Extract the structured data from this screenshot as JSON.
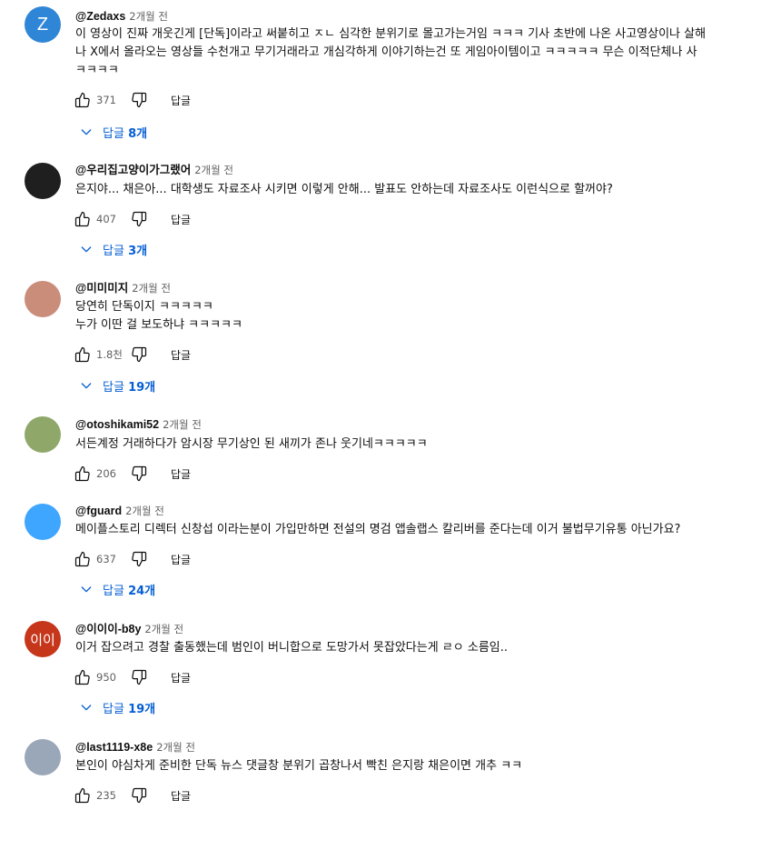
{
  "colors": {
    "accent_link": "#065fd4",
    "secondary_text": "#606060",
    "primary_text": "#0f0f0f"
  },
  "comments": [
    {
      "avatar_letter": "Z",
      "avatar_color": "#2f86d6",
      "author": "@Zedaxs",
      "time": "2개월 전",
      "lines": [
        "이 영상이 진짜 개웃긴게 [단독]이라고 써붙히고 ㅈㄴ 심각한 분위기로 몰고가는거임 ㅋㅋㅋ 기사 초반에 나온 사고영상이나 살해",
        "나 X에서 올라오는 영상들 수천개고 무기거래라고 개심각하게 이야기하는건 또 게임아이템이고 ㅋㅋㅋㅋㅋ 무슨 이적단체나 사",
        "ㅋㅋㅋㅋ"
      ],
      "likes": "371",
      "reply_label": "답글",
      "replies_toggle": "답글 8개"
    },
    {
      "avatar_letter": "",
      "avatar_color": "#1f1f1f",
      "author": "@우리집고양이가그랬어",
      "time": "2개월 전",
      "lines": [
        "은지야... 채은아... 대학생도 자료조사 시키면 이렇게 안해... 발표도 안하는데 자료조사도 이런식으로 할꺼야?"
      ],
      "likes": "407",
      "reply_label": "답글",
      "replies_toggle": "답글 3개"
    },
    {
      "avatar_letter": "",
      "avatar_color": "#c98d7a",
      "author": "@미미미지",
      "time": "2개월 전",
      "lines": [
        "당연히 단독이지 ㅋㅋㅋㅋㅋ",
        "누가 이딴 걸 보도하냐 ㅋㅋㅋㅋㅋ"
      ],
      "likes": "1.8천",
      "reply_label": "답글",
      "replies_toggle": "답글 19개"
    },
    {
      "avatar_letter": "",
      "avatar_color": "#8fa86a",
      "author": "@otoshikami52",
      "time": "2개월 전",
      "lines": [
        "서든계정 거래하다가 암시장 무기상인 된 새끼가 존나 웃기네ㅋㅋㅋㅋㅋ"
      ],
      "likes": "206",
      "reply_label": "답글",
      "replies_toggle": ""
    },
    {
      "avatar_letter": "",
      "avatar_color": "#3ea6ff",
      "author": "@fguard",
      "time": "2개월 전",
      "lines": [
        "메이플스토리 디렉터 신창섭 이라는분이 가입만하면 전설의 명검 앱솔랩스 칼리버를 준다는데 이거 불법무기유통 아닌가요?"
      ],
      "likes": "637",
      "reply_label": "답글",
      "replies_toggle": "답글 24개"
    },
    {
      "avatar_letter": "이이",
      "avatar_color": "#c6361b",
      "author": "@이이이-b8y",
      "time": "2개월 전",
      "lines": [
        "이거 잡으려고 경찰 출동했는데 범인이 버니합으로 도망가서 못잡았다는게 ㄹㅇ 소름임.."
      ],
      "likes": "950",
      "reply_label": "답글",
      "replies_toggle": "답글 19개"
    },
    {
      "avatar_letter": "",
      "avatar_color": "#9aa7b8",
      "author": "@last1119-x8e",
      "time": "2개월 전",
      "lines": [
        "본인이 야심차게 준비한 단독 뉴스 댓글창 분위기 곱창나서 빡친 은지랑 채은이면 개추 ㅋㅋ"
      ],
      "likes": "235",
      "reply_label": "답글",
      "replies_toggle": ""
    }
  ]
}
